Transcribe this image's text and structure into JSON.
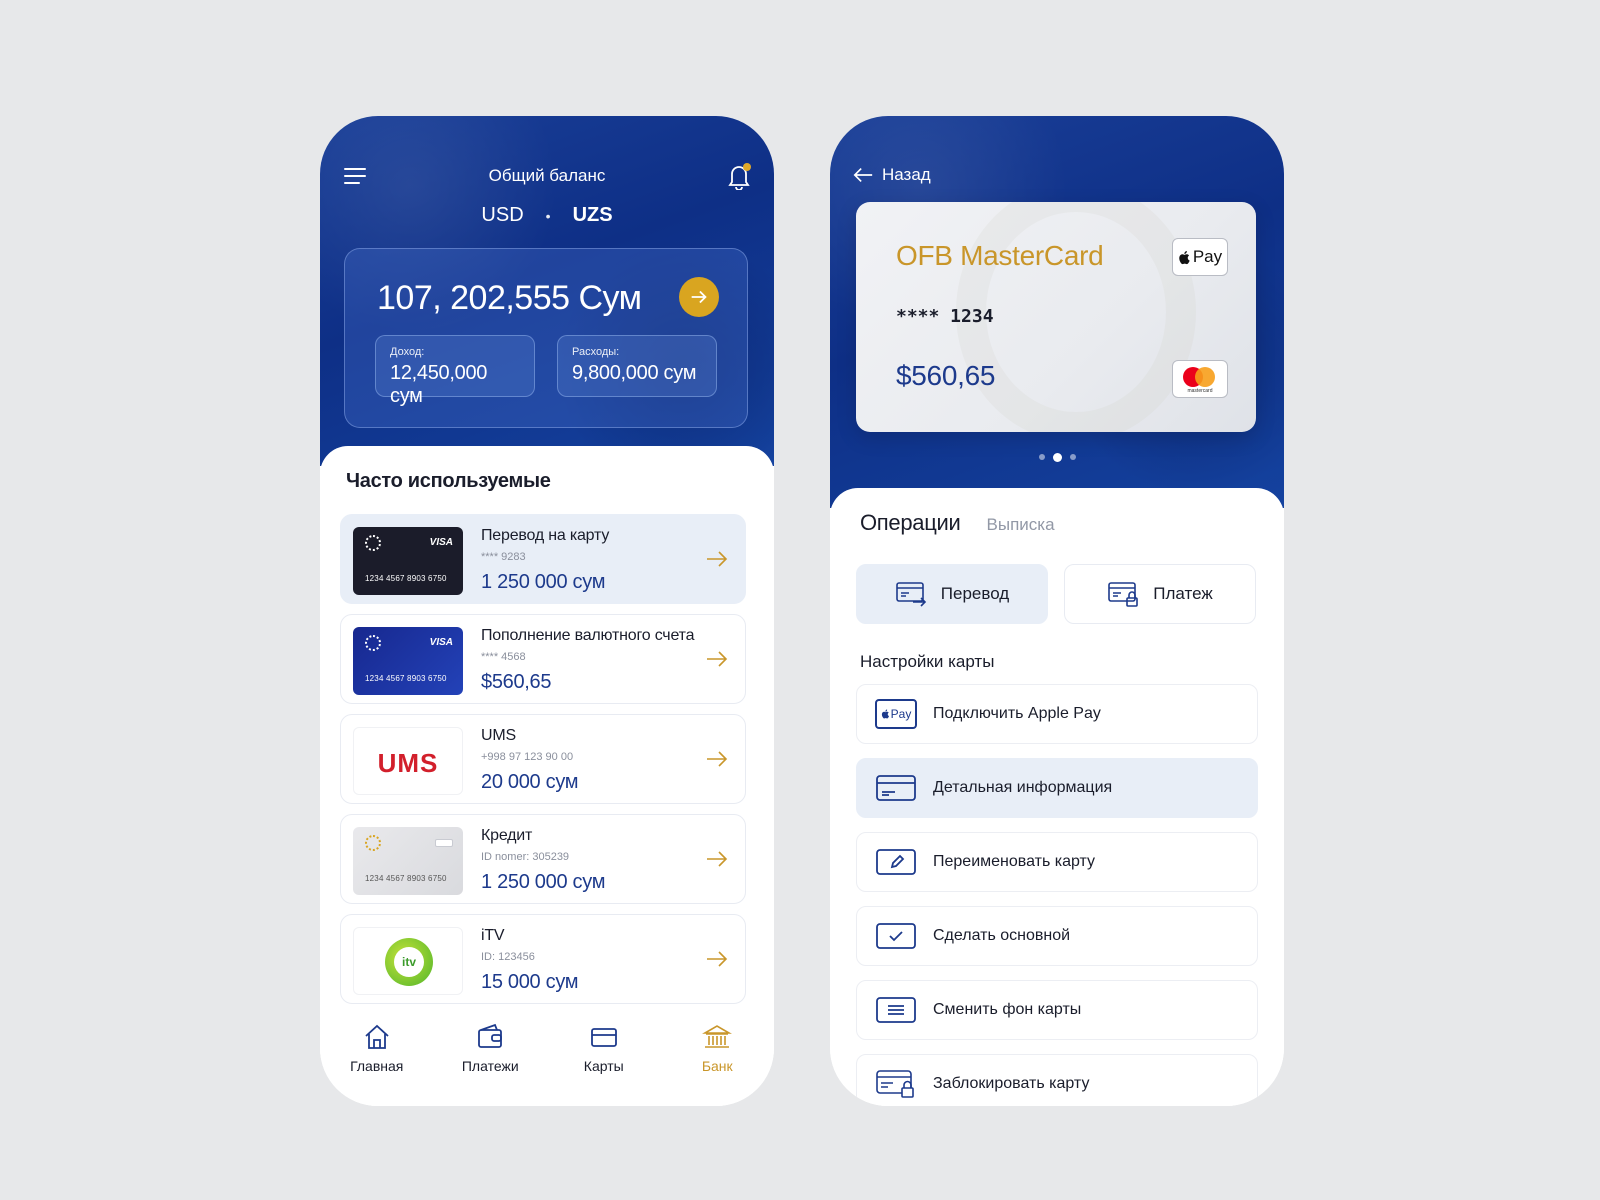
{
  "left": {
    "header": {
      "title": "Общий баланс",
      "currency_usd": "USD",
      "currency_separator": "•",
      "currency_uzs": "UZS",
      "selected_currency": "UZS"
    },
    "balance": {
      "amount": "107, 202,555 Сум",
      "income_label": "Доход:",
      "income_value": "12,450,000 сум",
      "expense_label": "Расходы:",
      "expense_value": "9,800,000 сум"
    },
    "favorites": {
      "title": "Часто используемые",
      "items": [
        {
          "title": "Перевод на карту",
          "sub": "**** 9283",
          "amount": "1 250 000 сум",
          "thumb": "visa-dark",
          "thumb_brand": "VISA",
          "thumb_number": "1234 4567 8903 6750"
        },
        {
          "title": "Пополнение валютного счета",
          "sub": "**** 4568",
          "amount": "$560,65",
          "thumb": "visa-blue",
          "thumb_brand": "VISA",
          "thumb_number": "1234 4567 8903 6750"
        },
        {
          "title": "UMS",
          "sub": "+998 97 123 90 00",
          "amount": "20 000 сум",
          "thumb": "ums",
          "thumb_brand": "UMS"
        },
        {
          "title": "Кредит",
          "sub": "ID nomer: 305239",
          "amount": "1 250 000 сум",
          "thumb": "card-gray",
          "thumb_number": "1234 4567 8903 6750"
        },
        {
          "title": "iTV",
          "sub": "ID: 123456",
          "amount": "15 000 сум",
          "thumb": "itv",
          "thumb_brand": "itv"
        }
      ]
    },
    "tabbar": {
      "items": [
        {
          "label": "Главная",
          "icon": "home-icon"
        },
        {
          "label": "Платежи",
          "icon": "wallet-icon"
        },
        {
          "label": "Карты",
          "icon": "card-icon"
        },
        {
          "label": "Банк",
          "icon": "bank-icon"
        }
      ],
      "active": "Банк"
    }
  },
  "right": {
    "back_label": "Назад",
    "card": {
      "title": "OFB MasterCard",
      "number": "**** 1234",
      "balance": "$560,65",
      "apple_pay": "Pay",
      "network": "mastercard"
    },
    "ops": {
      "tab_operations": "Операции",
      "tab_statement": "Выписка",
      "transfer_label": "Перевод",
      "payment_label": "Платеж"
    },
    "settings": {
      "title": "Настройки карты",
      "items": [
        {
          "label": "Подключить Apple Pay",
          "icon": "apple-pay-icon"
        },
        {
          "label": "Детальная информация",
          "icon": "card-info-icon"
        },
        {
          "label": "Переименовать карту",
          "icon": "pencil-icon"
        },
        {
          "label": "Сделать основной",
          "icon": "check-icon"
        },
        {
          "label": "Сменить фон карты",
          "icon": "lines-icon"
        },
        {
          "label": "Заблокировать карту",
          "icon": "card-lock-icon"
        }
      ]
    }
  },
  "colors": {
    "brand_blue": "#1d3a8c",
    "accent_gold": "#c9962a",
    "active_bg": "#e8eef7"
  }
}
